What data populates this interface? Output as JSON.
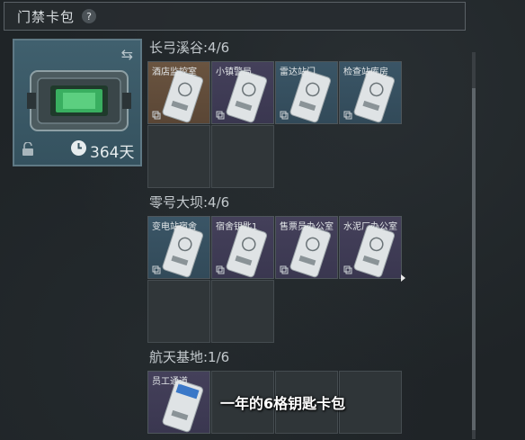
{
  "header": {
    "title": "门禁卡包",
    "help": "?"
  },
  "main_card": {
    "days": "364天",
    "icons": [
      "swap-icon",
      "lock-icon",
      "clock-icon"
    ]
  },
  "sections": [
    {
      "title": "长弓溪谷:4/6",
      "items": [
        {
          "label": "酒店监控室",
          "tint": "orange"
        },
        {
          "label": "小镇警局",
          "tint": "purple"
        },
        {
          "label": "雷达站门",
          "tint": "blue"
        },
        {
          "label": "检查站库房",
          "tint": "blue"
        }
      ]
    },
    {
      "title": "零号大坝:4/6",
      "items": [
        {
          "label": "变电站宿舍",
          "tint": "blue"
        },
        {
          "label": "宿舍钥匙1",
          "tint": "purple"
        },
        {
          "label": "售票员办公室",
          "tint": "purple"
        },
        {
          "label": "水泥厂办公室",
          "tint": "purple"
        }
      ]
    },
    {
      "title": "航天基地:1/6",
      "items": [
        {
          "label": "员工通道",
          "tint": "purple"
        }
      ]
    }
  ],
  "subtitle": "一年的6格钥匙卡包",
  "colors": {
    "orange": "#6a5440",
    "purple": "#44405a",
    "blue": "#3a5566",
    "card_frame": "#5f7985"
  }
}
